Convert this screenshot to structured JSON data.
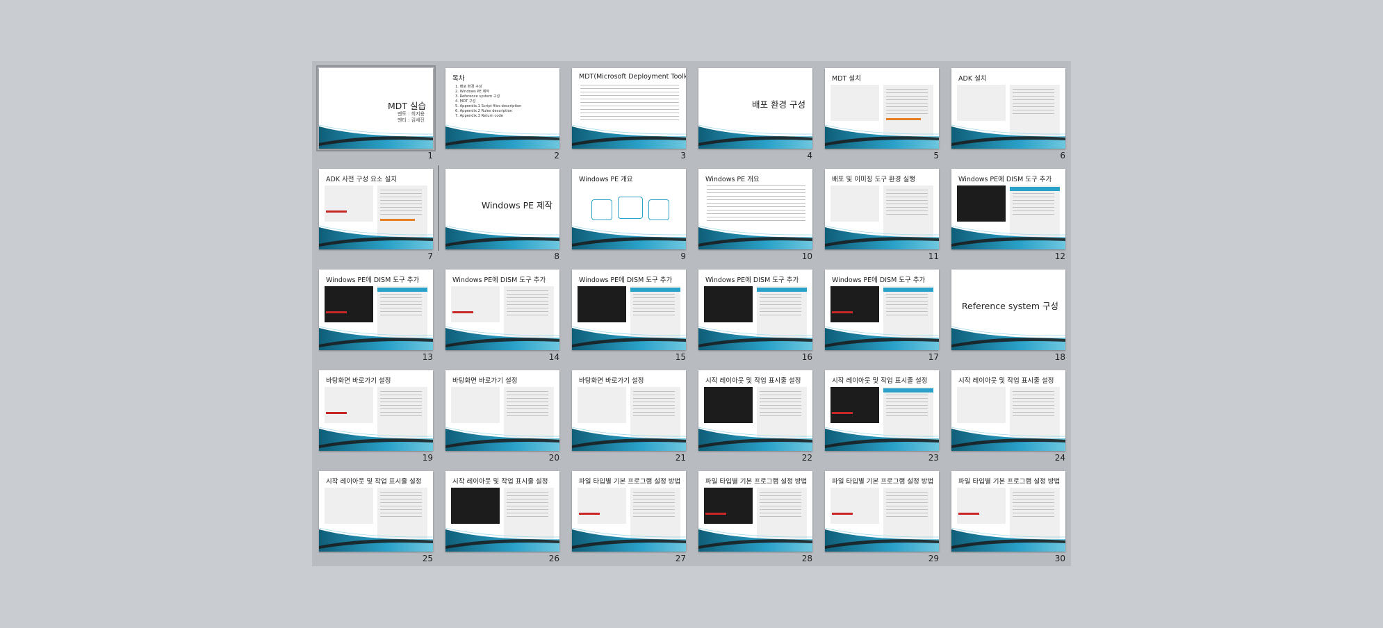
{
  "slides": [
    {
      "num": "1",
      "kind": "title",
      "title": "MDT 실습",
      "sub1": "멘토 : 최지용",
      "sub2": "멘티 : 김세진",
      "selected": true
    },
    {
      "num": "2",
      "kind": "toc",
      "title": "목차",
      "items": [
        "1. 배포 환경 구성",
        "2. Windows PE 제작",
        "3. Reference system 구성",
        "4. MDT 구성",
        "5. Appendix.1 Script files description",
        "6. Appendix.2 Rules description",
        "7. Appendix.3 Return code"
      ]
    },
    {
      "num": "3",
      "kind": "bullets",
      "title": "MDT(Microsoft Deployment Toolkit)"
    },
    {
      "num": "4",
      "kind": "section",
      "title": "배포 환경 구성"
    },
    {
      "num": "5",
      "kind": "content",
      "title": "MDT 설치"
    },
    {
      "num": "6",
      "kind": "content",
      "title": "ADK 설치"
    },
    {
      "num": "7",
      "kind": "content",
      "title": "ADK 사전 구성 요소 설치"
    },
    {
      "num": "8",
      "kind": "section",
      "title": "Windows PE 제작"
    },
    {
      "num": "9",
      "kind": "diagram",
      "title": "Windows PE 개요"
    },
    {
      "num": "10",
      "kind": "bullets",
      "title": "Windows PE 개요"
    },
    {
      "num": "11",
      "kind": "content",
      "title": "배포 및 이미징 도구 환경 실행"
    },
    {
      "num": "12",
      "kind": "content",
      "title": "Windows PE에 DISM 도구 추가"
    },
    {
      "num": "13",
      "kind": "content",
      "title": "Windows PE에 DISM 도구 추가"
    },
    {
      "num": "14",
      "kind": "content",
      "title": "Windows PE에 DISM 도구 추가"
    },
    {
      "num": "15",
      "kind": "content",
      "title": "Windows PE에 DISM 도구 추가"
    },
    {
      "num": "16",
      "kind": "content",
      "title": "Windows PE에 DISM 도구 추가"
    },
    {
      "num": "17",
      "kind": "content",
      "title": "Windows PE에 DISM 도구 추가"
    },
    {
      "num": "18",
      "kind": "section",
      "title": "Reference system 구성"
    },
    {
      "num": "19",
      "kind": "content",
      "title": "바탕화면 바로가기 설정"
    },
    {
      "num": "20",
      "kind": "content",
      "title": "바탕화면 바로가기 설정"
    },
    {
      "num": "21",
      "kind": "content",
      "title": "바탕화면 바로가기 설정"
    },
    {
      "num": "22",
      "kind": "content",
      "title": "시작 레이아웃 및 작업 표시줄 설정"
    },
    {
      "num": "23",
      "kind": "content",
      "title": "시작 레이아웃 및 작업 표시줄 설정"
    },
    {
      "num": "24",
      "kind": "content",
      "title": "시작 레이아웃 및 작업 표시줄 설정"
    },
    {
      "num": "25",
      "kind": "content",
      "title": "시작 레이아웃 및 작업 표시줄 설정"
    },
    {
      "num": "26",
      "kind": "content",
      "title": "시작 레이아웃 및 작업 표시줄 설정"
    },
    {
      "num": "27",
      "kind": "content",
      "title": "파일 타입별 기본 프로그램 설정 방법"
    },
    {
      "num": "28",
      "kind": "content",
      "title": "파일 타입별 기본 프로그램 설정 방법"
    },
    {
      "num": "29",
      "kind": "content",
      "title": "파일 타입별 기본 프로그램 설정 방법"
    },
    {
      "num": "30",
      "kind": "content",
      "title": "파일 타입별 기본 프로그램 설정 방법"
    }
  ],
  "colors": {
    "accent": "#2aa1c9",
    "wave_dark": "#0f5e78",
    "wave_light": "#6ec7df",
    "background": "#c9ccd1",
    "grid": "#b8bbc0"
  }
}
